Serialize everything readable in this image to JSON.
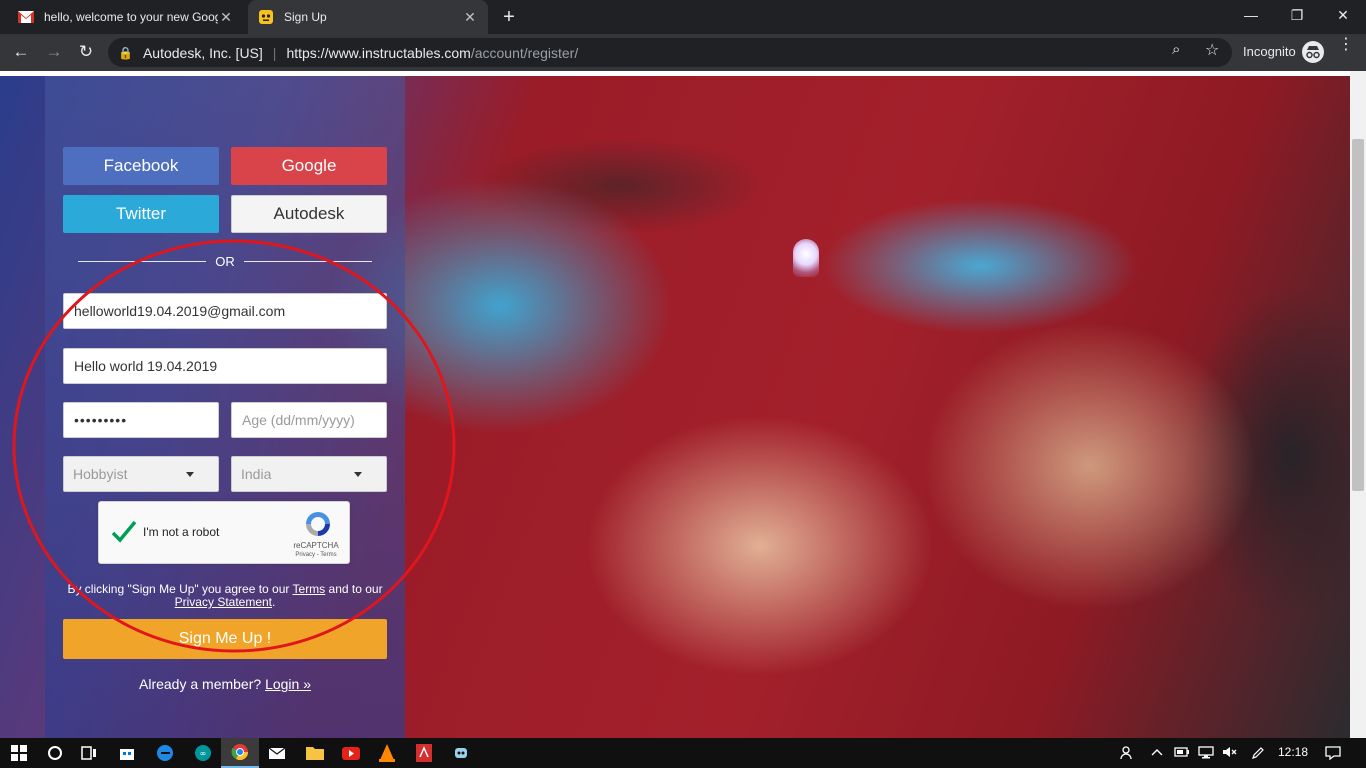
{
  "browser": {
    "tabs": [
      {
        "title": "hello, welcome to your new Goog",
        "favicon": "gmail-icon",
        "active": false
      },
      {
        "title": "Sign Up",
        "favicon": "instructables-robot-icon",
        "active": true
      }
    ],
    "new_tab": "+",
    "window_controls": {
      "minimize": "—",
      "restore": "❐",
      "close": "✕"
    },
    "nav": {
      "back": "←",
      "forward": "→",
      "reload": "↻"
    },
    "omnibox": {
      "lock": "🔒",
      "site_identity": "Autodesk, Inc. [US]",
      "separator": "|",
      "url_host": "https://www.instructables.com",
      "url_path": "/account/register/"
    },
    "zoom_icon": "⌕",
    "bookmark_icon": "☆",
    "profile_label": "Incognito",
    "menu": "⋮"
  },
  "signup": {
    "social": {
      "facebook": "Facebook",
      "google": "Google",
      "twitter": "Twitter",
      "autodesk": "Autodesk"
    },
    "divider": "OR",
    "email_value": "helloworld19.04.2019@gmail.com",
    "username_value": "Hello world 19.04.2019",
    "password_masked": "•••••••••",
    "age_placeholder": "Age (dd/mm/yyyy)",
    "role_select": "Hobbyist",
    "country_select": "India",
    "recaptcha": {
      "label": "I'm not a robot",
      "brand": "reCAPTCHA",
      "links": "Privacy - Terms",
      "checked": true
    },
    "legal": {
      "prefix": "By clicking \"Sign Me Up\" you agree to our ",
      "terms": "Terms",
      "middle": " and to our",
      "privacy": "Privacy Statement",
      "suffix": "."
    },
    "submit": "Sign Me Up !",
    "login_prompt": "Already a member? ",
    "login_link": "Login »"
  },
  "colors": {
    "facebook": "#4e6fbf",
    "google": "#d9434a",
    "twitter": "#2ba9d8",
    "signup": "#f0a52a",
    "annotation": "#e0161c"
  },
  "taskbar": {
    "clock": "12:18"
  }
}
